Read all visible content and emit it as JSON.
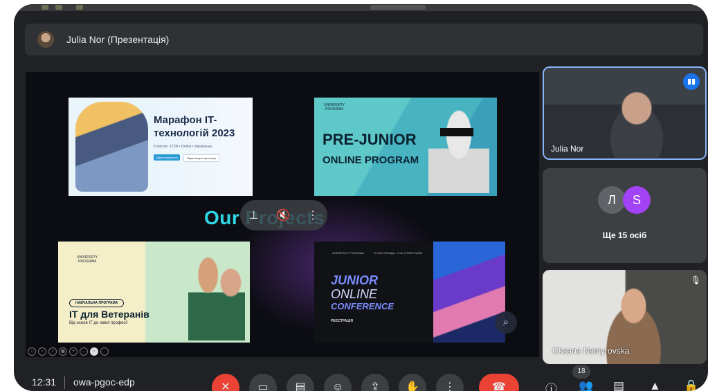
{
  "presenter": {
    "title": "Julia Nor (Презентація)"
  },
  "slide": {
    "headline": "Our Projects",
    "card1": {
      "title": "Марафон IT-технологій 2023",
      "subtitle": "5 листоп. 17:00 • Online • Українська",
      "btn1": "Зареєструватися",
      "btn2": "Переглянути програму"
    },
    "card2": {
      "logo": "UNIVERSITY PROGRAM",
      "line1": "PRE-JUNIOR",
      "line2": "ONLINE PROGRAM"
    },
    "card3": {
      "logo": "UNIVERSITY PROGRAM",
      "pill": "НАВЧАЛЬНА ПРОГРАМА",
      "title": "IT для Ветеранів",
      "subtitle": "Від основ IT до нової професії"
    },
    "card4": {
      "logo": "UNIVERSITY PROGRAM",
      "header": "18 ЛИСТОПАДА, 12:00 | FREE EVENT",
      "line1": "JUNIOR",
      "line2": "ONLINE",
      "line3": "CONFERENCE",
      "register": "РЕЄСТРАЦІЯ"
    }
  },
  "tiles": {
    "julia": {
      "name": "Julia Nor"
    },
    "others": {
      "avatar1": "Л",
      "avatar2": "S",
      "more": "Ще 15 осіб"
    },
    "oksana": {
      "name": "Oksana Nemyrovska"
    }
  },
  "bottom": {
    "clock": "12:31",
    "meeting_code": "owa-pgoc-edp",
    "participants_count": "18"
  },
  "colors": {
    "accent": "#8ab4f8",
    "end_call": "#ea4335",
    "headline": "#2fd7e8",
    "avatar_s": "#a142f4"
  }
}
